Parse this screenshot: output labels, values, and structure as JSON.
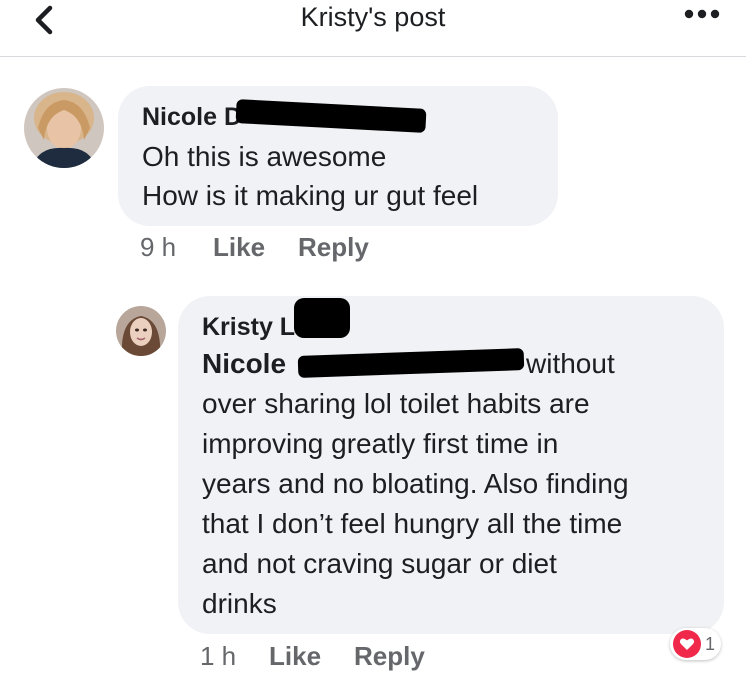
{
  "header": {
    "title": "Kristy's post",
    "back_icon": "chevron-left-icon",
    "more_icon": "more-dots-icon"
  },
  "comments": [
    {
      "author": "Nicole D",
      "lines": [
        "Oh this is awesome",
        "How is it making ur gut feel"
      ],
      "time": "9 h",
      "like": "Like",
      "reply": "Reply"
    }
  ],
  "replies": [
    {
      "author": "Kristy L",
      "mention": "Nicole",
      "first_line_rest": "without",
      "lines": [
        "over sharing lol toilet habits are",
        "improving greatly first time in",
        "years and no bloating. Also finding",
        "that I don’t feel hungry all the time",
        "and not craving sugar or diet",
        "drinks"
      ],
      "time": "1 h",
      "like": "Like",
      "reply": "Reply",
      "reaction": {
        "icon": "heart-icon",
        "count": "1",
        "color": "#f02849"
      }
    }
  ],
  "colors": {
    "bubble": "#f0f2f5",
    "meta_text": "#65676b",
    "redaction": "#000000"
  }
}
